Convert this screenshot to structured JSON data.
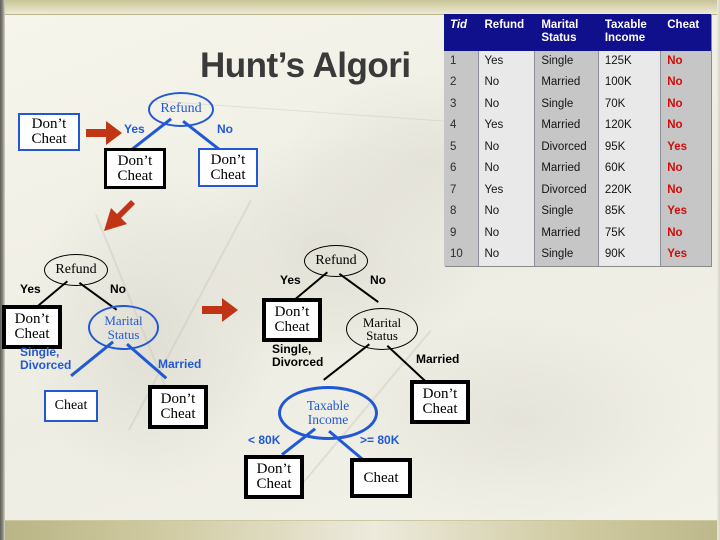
{
  "slide": {
    "title": "Hunt’s Algori",
    "title_full": "Hunt’s Algorithm",
    "accent_blue": "#2159d4",
    "accent_red": "#c03515",
    "header_navy": "#10108c",
    "cheat_red": "#d00b0b"
  },
  "table": {
    "headers": [
      "Tid",
      "Refund",
      "Marital Status",
      "Taxable Income",
      "Cheat"
    ],
    "rows": [
      [
        "1",
        "Yes",
        "Single",
        "125K",
        "No"
      ],
      [
        "2",
        "No",
        "Married",
        "100K",
        "No"
      ],
      [
        "3",
        "No",
        "Single",
        "70K",
        "No"
      ],
      [
        "4",
        "Yes",
        "Married",
        "120K",
        "No"
      ],
      [
        "5",
        "No",
        "Divorced",
        "95K",
        "Yes"
      ],
      [
        "6",
        "No",
        "Married",
        "60K",
        "No"
      ],
      [
        "7",
        "Yes",
        "Divorced",
        "220K",
        "No"
      ],
      [
        "8",
        "No",
        "Single",
        "85K",
        "Yes"
      ],
      [
        "9",
        "No",
        "Married",
        "75K",
        "No"
      ],
      [
        "10",
        "No",
        "Single",
        "90K",
        "Yes"
      ]
    ]
  },
  "tree1": {
    "start_box": {
      "line1": "Don’t",
      "line2": "Cheat"
    },
    "root": "Refund",
    "label_yes": "Yes",
    "label_no": "No",
    "leaf_yes": {
      "line1": "Don’t",
      "line2": "Cheat"
    },
    "leaf_no": {
      "line1": "Don’t",
      "line2": "Cheat"
    }
  },
  "tree2": {
    "root": "Refund",
    "label_yes": "Yes",
    "label_no": "No",
    "leaf_yes": {
      "line1": "Don’t",
      "line2": "Cheat"
    },
    "node_marital_line1": "Marital",
    "node_marital_line2": "Status",
    "label_single_line1": "Single,",
    "label_single_line2": "Divorced",
    "label_married": "Married",
    "leaf_single": "Cheat",
    "leaf_married": {
      "line1": "Don’t",
      "line2": "Cheat"
    }
  },
  "tree3": {
    "root": "Refund",
    "label_yes": "Yes",
    "label_no": "No",
    "leaf_yes": {
      "line1": "Don’t",
      "line2": "Cheat"
    },
    "node_marital_line1": "Marital",
    "node_marital_line2": "Status",
    "label_single_line1": "Single,",
    "label_single_line2": "Divorced",
    "label_married": "Married",
    "leaf_married": {
      "line1": "Don’t",
      "line2": "Cheat"
    },
    "node_income_line1": "Taxable",
    "node_income_line2": "Income",
    "label_lt80k": "< 80K",
    "label_ge80k": ">= 80K",
    "leaf_lt80k": {
      "line1": "Don’t",
      "line2": "Cheat"
    },
    "leaf_ge80k": "Cheat"
  },
  "arrows": {
    "arrow1_name": "right-arrow-icon",
    "arrow2_name": "down-left-arrow-icon",
    "arrow3_name": "right-arrow-icon"
  }
}
